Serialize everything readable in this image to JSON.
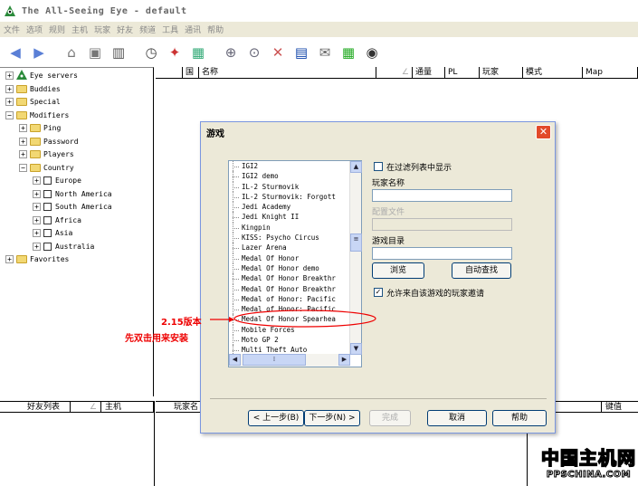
{
  "window": {
    "title": "The All-Seeing Eye - default"
  },
  "menu": [
    "文件",
    "选项",
    "规则",
    "主机",
    "玩家",
    "好友",
    "频道",
    "工具",
    "通讯",
    "帮助"
  ],
  "toolbar": [
    "back-icon",
    "forward-icon",
    "game-icon",
    "game-settings-icon",
    "server-icon",
    "timer-icon",
    "refresh-icon",
    "filter-icon",
    "search-icon",
    "zoom-icon",
    "tools-icon",
    "irc-icon",
    "mail-icon",
    "chat-icon",
    "help-icon"
  ],
  "tree": [
    {
      "label": "Eye servers",
      "level": 0,
      "expander": "+",
      "icon": "eye"
    },
    {
      "label": "Buddies",
      "level": 0,
      "expander": "+",
      "icon": "folder"
    },
    {
      "label": "Special",
      "level": 0,
      "expander": "+",
      "icon": "folder"
    },
    {
      "label": "Modifiers",
      "level": 0,
      "expander": "−",
      "icon": "folder"
    },
    {
      "label": "Ping",
      "level": 1,
      "expander": "+",
      "icon": "folder"
    },
    {
      "label": "Password",
      "level": 1,
      "expander": "+",
      "icon": "folder"
    },
    {
      "label": "Players",
      "level": 1,
      "expander": "+",
      "icon": "folder"
    },
    {
      "label": "Country",
      "level": 1,
      "expander": "−",
      "icon": "folder"
    },
    {
      "label": "Europe",
      "level": 2,
      "expander": "+",
      "icon": "check"
    },
    {
      "label": "North America",
      "level": 2,
      "expander": "+",
      "icon": "check"
    },
    {
      "label": "South America",
      "level": 2,
      "expander": "+",
      "icon": "check"
    },
    {
      "label": "Africa",
      "level": 2,
      "expander": "+",
      "icon": "check"
    },
    {
      "label": "Asia",
      "level": 2,
      "expander": "+",
      "icon": "check"
    },
    {
      "label": "Australia",
      "level": 2,
      "expander": "+",
      "icon": "check"
    },
    {
      "label": "Favorites",
      "level": 0,
      "expander": "+",
      "icon": "folder"
    }
  ],
  "server_columns": [
    "",
    "国",
    "名称",
    "∠",
    "通量",
    "PL",
    "玩家",
    "模式",
    "Map"
  ],
  "friends_columns": [
    "好友列表",
    "∠",
    "主机"
  ],
  "players_column": "玩家名",
  "rules_columns": [
    "",
    "键值"
  ],
  "dialog": {
    "title": "游戏",
    "games": [
      "IGI2",
      "IGI2 demo",
      "IL-2 Sturmovik",
      "IL-2 Sturmovik: Forgott",
      "Jedi Academy",
      "Jedi Knight II",
      "Kingpin",
      "KISS: Psycho Circus",
      "Lazer Arena",
      "Medal Of Honor",
      "Medal Of Honor demo",
      "Medal Of Honor Breakthr",
      "Medal Of Honor Breakthr",
      "Medal of Honor: Pacific",
      "Medal of Honor: Pacific",
      "Medal Of Honor Spearhea",
      "Mobile Forces",
      "Moto GP 2",
      "Multi Theft Auto"
    ],
    "selected_index": 15,
    "show_in_filter_label": "在过滤列表中显示",
    "show_in_filter_checked": false,
    "player_name_label": "玩家名称",
    "player_name_value": "",
    "config_file_label": "配置文件",
    "config_file_value": "",
    "game_dir_label": "游戏目录",
    "game_dir_value": "",
    "browse_button": "浏览",
    "auto_find_button": "自动查找",
    "allow_invites_label": "允许来自该游戏的玩家邀请",
    "allow_invites_checked": true,
    "back_button": "< 上一步(B)",
    "next_button": "下一步(N) >",
    "finish_button": "完成",
    "cancel_button": "取消",
    "help_button": "帮助"
  },
  "annotations": {
    "step": "2.15版本",
    "hint": "先双击用来安装"
  },
  "logo": {
    "line1": "中国主机网",
    "line2": "PPSCHINA.COM"
  }
}
